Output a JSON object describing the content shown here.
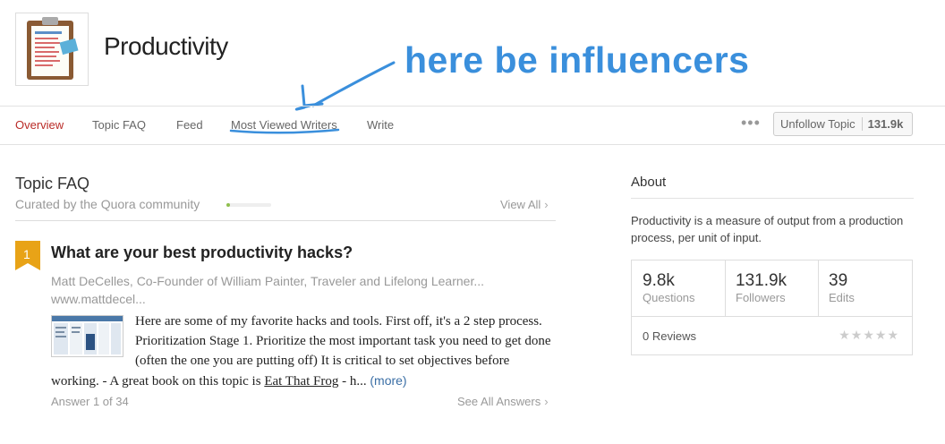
{
  "topic": {
    "title": "Productivity"
  },
  "annotation": {
    "text": "here be influencers",
    "color": "#3a8fdc"
  },
  "tabs": [
    {
      "label": "Overview",
      "active": true
    },
    {
      "label": "Topic FAQ",
      "active": false
    },
    {
      "label": "Feed",
      "active": false
    },
    {
      "label": "Most Viewed Writers",
      "active": false
    },
    {
      "label": "Write",
      "active": false
    }
  ],
  "actions": {
    "more_label": "•••",
    "unfollow_label": "Unfollow Topic",
    "follower_count": "131.9k"
  },
  "faq": {
    "title": "Topic FAQ",
    "subtitle": "Curated by the Quora community",
    "progress_fraction": 0.08,
    "view_all": "View All",
    "rank": "1",
    "question": "What are your best productivity hacks?",
    "author": "Matt DeCelles, Co-Founder of William Painter, Traveler and Lifelong Learner... www.mattdecel...",
    "answer_pre": "Here are some of my favorite hacks and tools. First off, it's a 2 step process. Prioritization Stage 1. Prioritize the most important task you need to get done (often the one you are putting off) It is critical to set objectives before working. - A great book on this topic is ",
    "answer_link": "Eat That Frog",
    "answer_post": " - h...",
    "more": "(more)",
    "answer_count": "Answer 1 of 34",
    "see_all": "See All Answers"
  },
  "about": {
    "title": "About",
    "description": "Productivity is a measure of output from a production process, per unit of input.",
    "stats": [
      {
        "value": "9.8k",
        "label": "Questions"
      },
      {
        "value": "131.9k",
        "label": "Followers"
      },
      {
        "value": "39",
        "label": "Edits"
      }
    ],
    "reviews": "0 Reviews",
    "stars": "★★★★★",
    "rating_fraction": 0
  },
  "colors": {
    "active_tab": "#b92b27",
    "rank_badge": "#e8a317",
    "link": "#3a6ea5"
  }
}
